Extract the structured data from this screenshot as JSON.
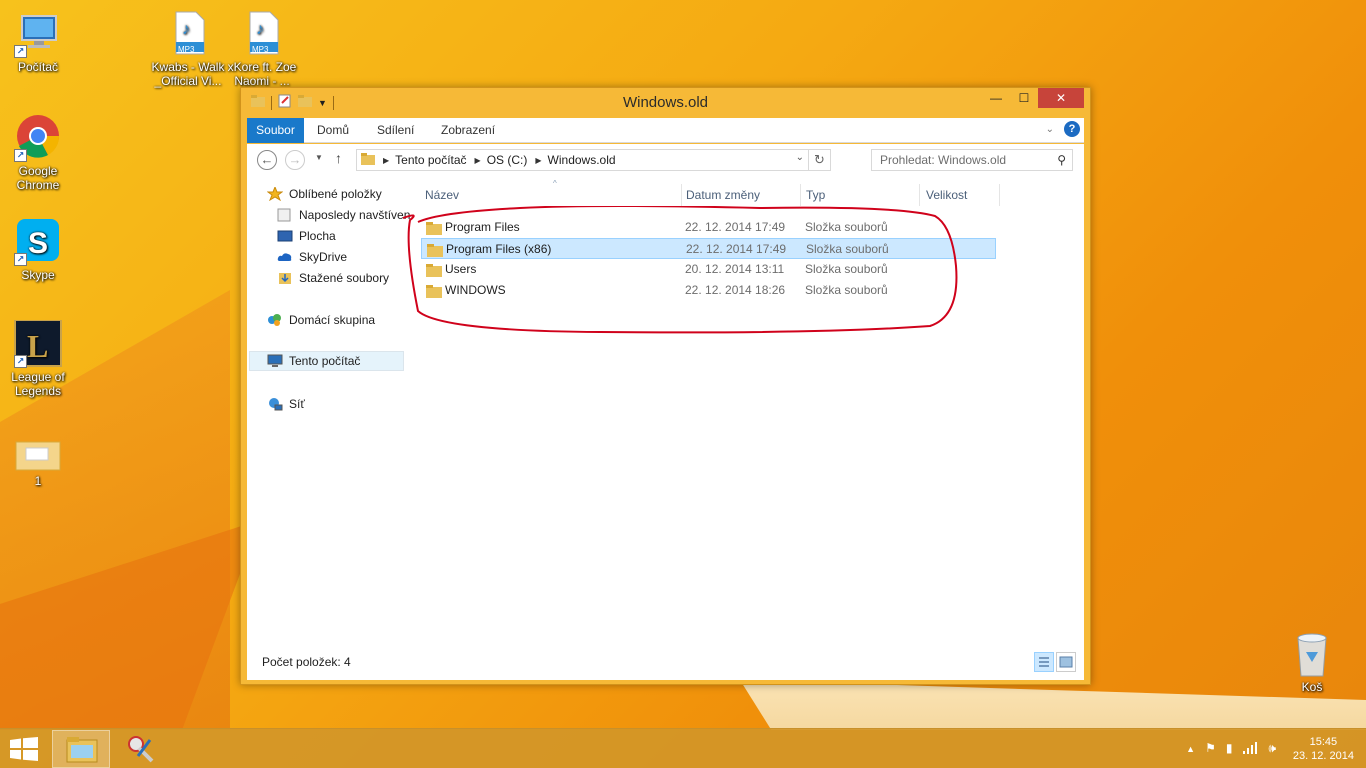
{
  "desktop": {
    "icons": [
      {
        "label": "Počítač",
        "icon": "computer-icon"
      },
      {
        "label": "Kwabs - Walk _Official Vi...",
        "icon": "mp3-file-icon"
      },
      {
        "label": "xKore ft. Zoe Naomi - ...",
        "icon": "mp3-file-icon"
      },
      {
        "label": "Google Chrome",
        "icon": "chrome-icon"
      },
      {
        "label": "Skype",
        "icon": "skype-icon"
      },
      {
        "label": "League of Legends",
        "icon": "league-of-legends-icon"
      },
      {
        "label": "1",
        "icon": "folder-icon"
      },
      {
        "label": "Koš",
        "icon": "recycle-bin-icon"
      }
    ],
    "mp3_badge": "MP3"
  },
  "window": {
    "title": "Windows.old",
    "ribbon_tabs": [
      "Soubor",
      "Domů",
      "Sdílení",
      "Zobrazení"
    ],
    "close_glyph": "✕",
    "maximize_glyph": "☐",
    "minimize_glyph": "—",
    "help_glyph": "?",
    "address": {
      "segments": [
        "Tento počítač",
        "OS (C:)",
        "Windows.old"
      ]
    },
    "search_placeholder": "Prohledat: Windows.old",
    "nav": {
      "favorites": "Oblíbené položky",
      "recent": "Naposledy navštíven",
      "desktop": "Plocha",
      "skydrive": "SkyDrive",
      "downloads": "Stažené soubory",
      "homegroup": "Domácí skupina",
      "thispc": "Tento počítač",
      "network": "Síť"
    },
    "columns": {
      "name": "Název",
      "date": "Datum změny",
      "type": "Typ",
      "size": "Velikost"
    },
    "files": [
      {
        "name": "Program Files",
        "date": "22. 12. 2014 17:49",
        "type": "Složka souborů"
      },
      {
        "name": "Program Files (x86)",
        "date": "22. 12. 2014 17:49",
        "type": "Složka souborů"
      },
      {
        "name": "Users",
        "date": "20. 12. 2014 13:11",
        "type": "Složka souborů"
      },
      {
        "name": "WINDOWS",
        "date": "22. 12. 2014 18:26",
        "type": "Složka souborů"
      }
    ],
    "status": "Počet položek: 4"
  },
  "taskbar": {
    "time": "15:45",
    "date": "23. 12. 2014"
  },
  "colors": {
    "accent": "#1979ca",
    "annotation": "#d0021b",
    "selection": "#cce8ff"
  }
}
